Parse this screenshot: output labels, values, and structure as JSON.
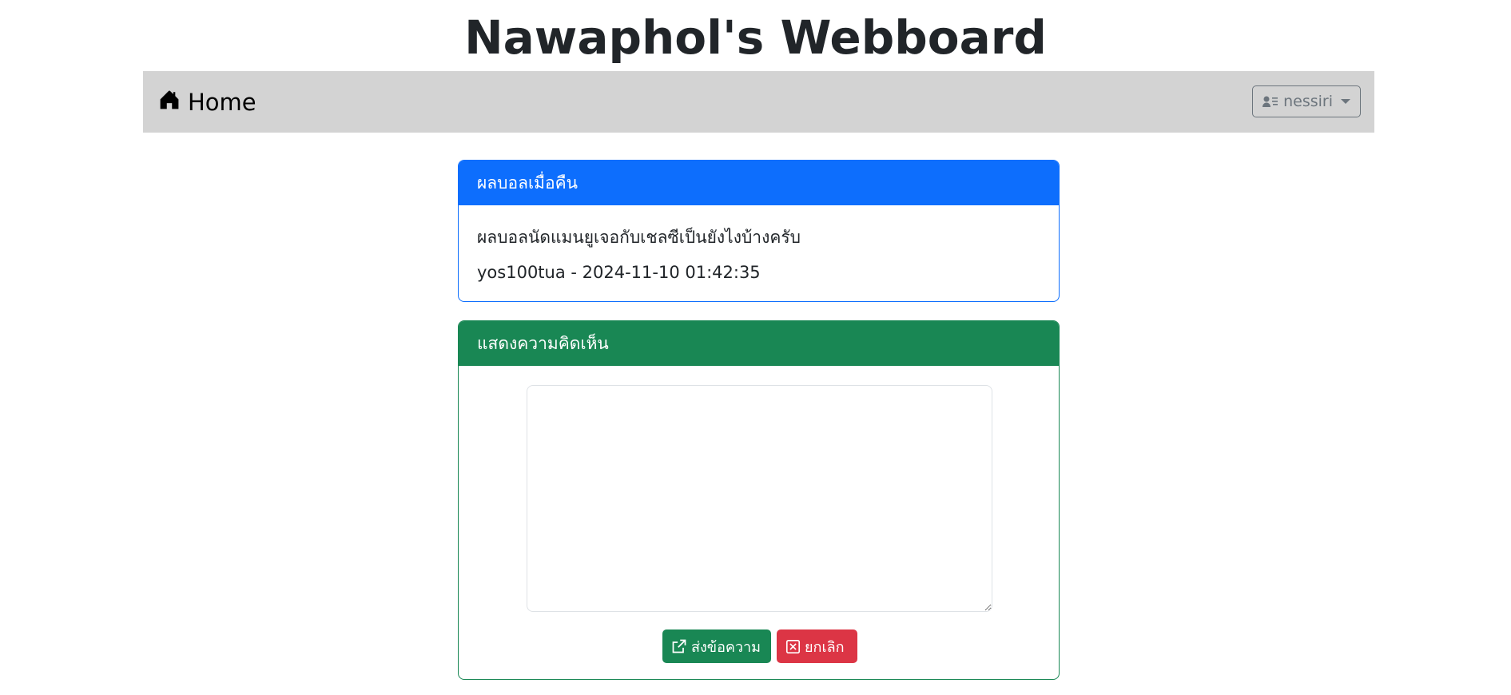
{
  "site": {
    "title": "Nawaphol's Webboard"
  },
  "navbar": {
    "home_label": "Home",
    "user_label": "nessiri",
    "background": "#d3d3d3"
  },
  "post": {
    "title": "ผลบอลเมื่อคืน",
    "content": "ผลบอลนัดแมนยูเจอกับเชลซีเป็นยังไงบ้างครับ",
    "meta": "yos100tua - 2024-11-10 01:42:35",
    "header_color": "#0d6efd"
  },
  "comment": {
    "title": "แสดงความคิดเห็น",
    "textarea_value": "",
    "send_label": "ส่งข้อความ",
    "cancel_label": "ยกเลิก",
    "header_color": "#198754",
    "cancel_color": "#dc3545"
  },
  "icons": {
    "home": "house-icon",
    "user": "person-lines-icon",
    "send": "box-arrow-up-right-icon",
    "cancel": "x-square-icon"
  }
}
